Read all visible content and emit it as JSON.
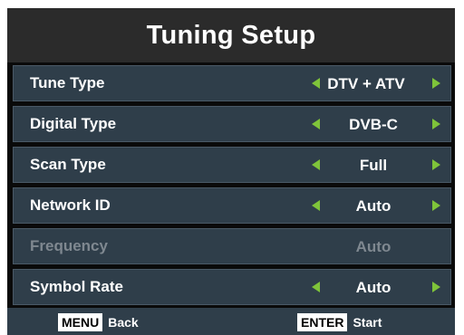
{
  "title": "Tuning Setup",
  "rows": [
    {
      "label": "Tune Type",
      "value": "DTV + ATV",
      "enabled": true
    },
    {
      "label": "Digital Type",
      "value": "DVB-C",
      "enabled": true
    },
    {
      "label": "Scan Type",
      "value": "Full",
      "enabled": true
    },
    {
      "label": "Network ID",
      "value": "Auto",
      "enabled": true
    },
    {
      "label": "Frequency",
      "value": "Auto",
      "enabled": false
    },
    {
      "label": "Symbol Rate",
      "value": "Auto",
      "enabled": true
    }
  ],
  "footer": {
    "menu_key": "MENU",
    "menu_action": "Back",
    "enter_key": "ENTER",
    "enter_action": "Start"
  },
  "colors": {
    "arrow": "#7fc43a",
    "row_bg": "#2f3e4a",
    "title_bg": "#2b2b2b"
  }
}
